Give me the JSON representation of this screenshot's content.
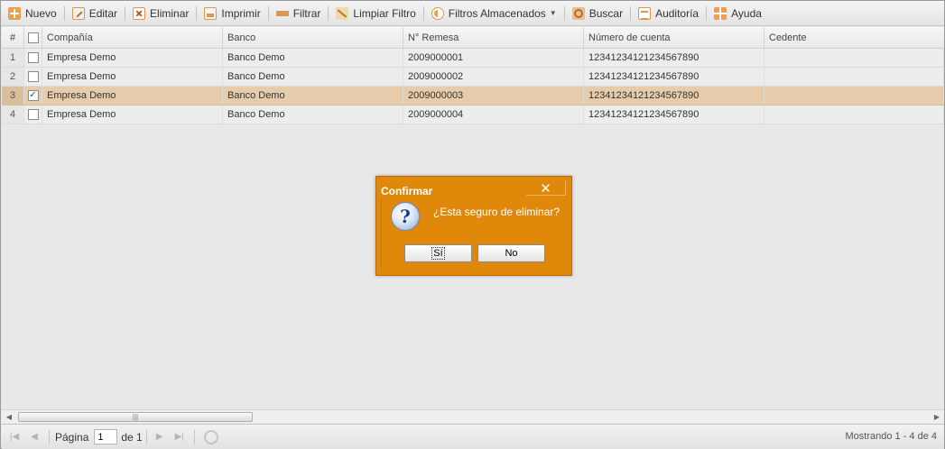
{
  "toolbar": {
    "buttons": [
      {
        "label": "Nuevo",
        "icon": "plus-icon"
      },
      {
        "label": "Editar",
        "icon": "edit-icon"
      },
      {
        "label": "Eliminar",
        "icon": "delete-icon"
      },
      {
        "label": "Imprimir",
        "icon": "print-icon"
      },
      {
        "label": "Filtrar",
        "icon": "filter-icon"
      },
      {
        "label": "Limpiar Filtro",
        "icon": "clear-filter-icon"
      },
      {
        "label": "Filtros Almacenados",
        "icon": "stored-filters-icon"
      },
      {
        "label": "Buscar",
        "icon": "search-icon"
      },
      {
        "label": "Auditoría",
        "icon": "audit-icon"
      },
      {
        "label": "Ayuda",
        "icon": "help-icon"
      }
    ]
  },
  "grid": {
    "columns": [
      "#",
      "Compañía",
      "Banco",
      "N° Remesa",
      "Número de cuenta",
      "Cedente"
    ],
    "rows": [
      {
        "num": "1",
        "checked": false,
        "company": "Empresa Demo",
        "bank": "Banco Demo",
        "remesa": "2009000001",
        "account": "12341234121234567890",
        "cedente": ""
      },
      {
        "num": "2",
        "checked": false,
        "company": "Empresa Demo",
        "bank": "Banco Demo",
        "remesa": "2009000002",
        "account": "12341234121234567890",
        "cedente": ""
      },
      {
        "num": "3",
        "checked": true,
        "company": "Empresa Demo",
        "bank": "Banco Demo",
        "remesa": "2009000003",
        "account": "12341234121234567890",
        "cedente": ""
      },
      {
        "num": "4",
        "checked": false,
        "company": "Empresa Demo",
        "bank": "Banco Demo",
        "remesa": "2009000004",
        "account": "12341234121234567890",
        "cedente": ""
      }
    ],
    "selected_row": 3
  },
  "pager": {
    "page_label": "Página",
    "page_value": "1",
    "of_label": "de 1",
    "info": "Mostrando 1 - 4 de 4"
  },
  "dialog": {
    "title": "Confirmar",
    "close_glyph": "✕",
    "icon_glyph": "?",
    "message": "¿Esta seguro de eliminar?",
    "yes_label": "Sí",
    "no_label": "No"
  },
  "colors": {
    "dialog_bg": "#e0880a",
    "selected_row": "#e6ccaa",
    "accent_icon": "#e9a050"
  }
}
